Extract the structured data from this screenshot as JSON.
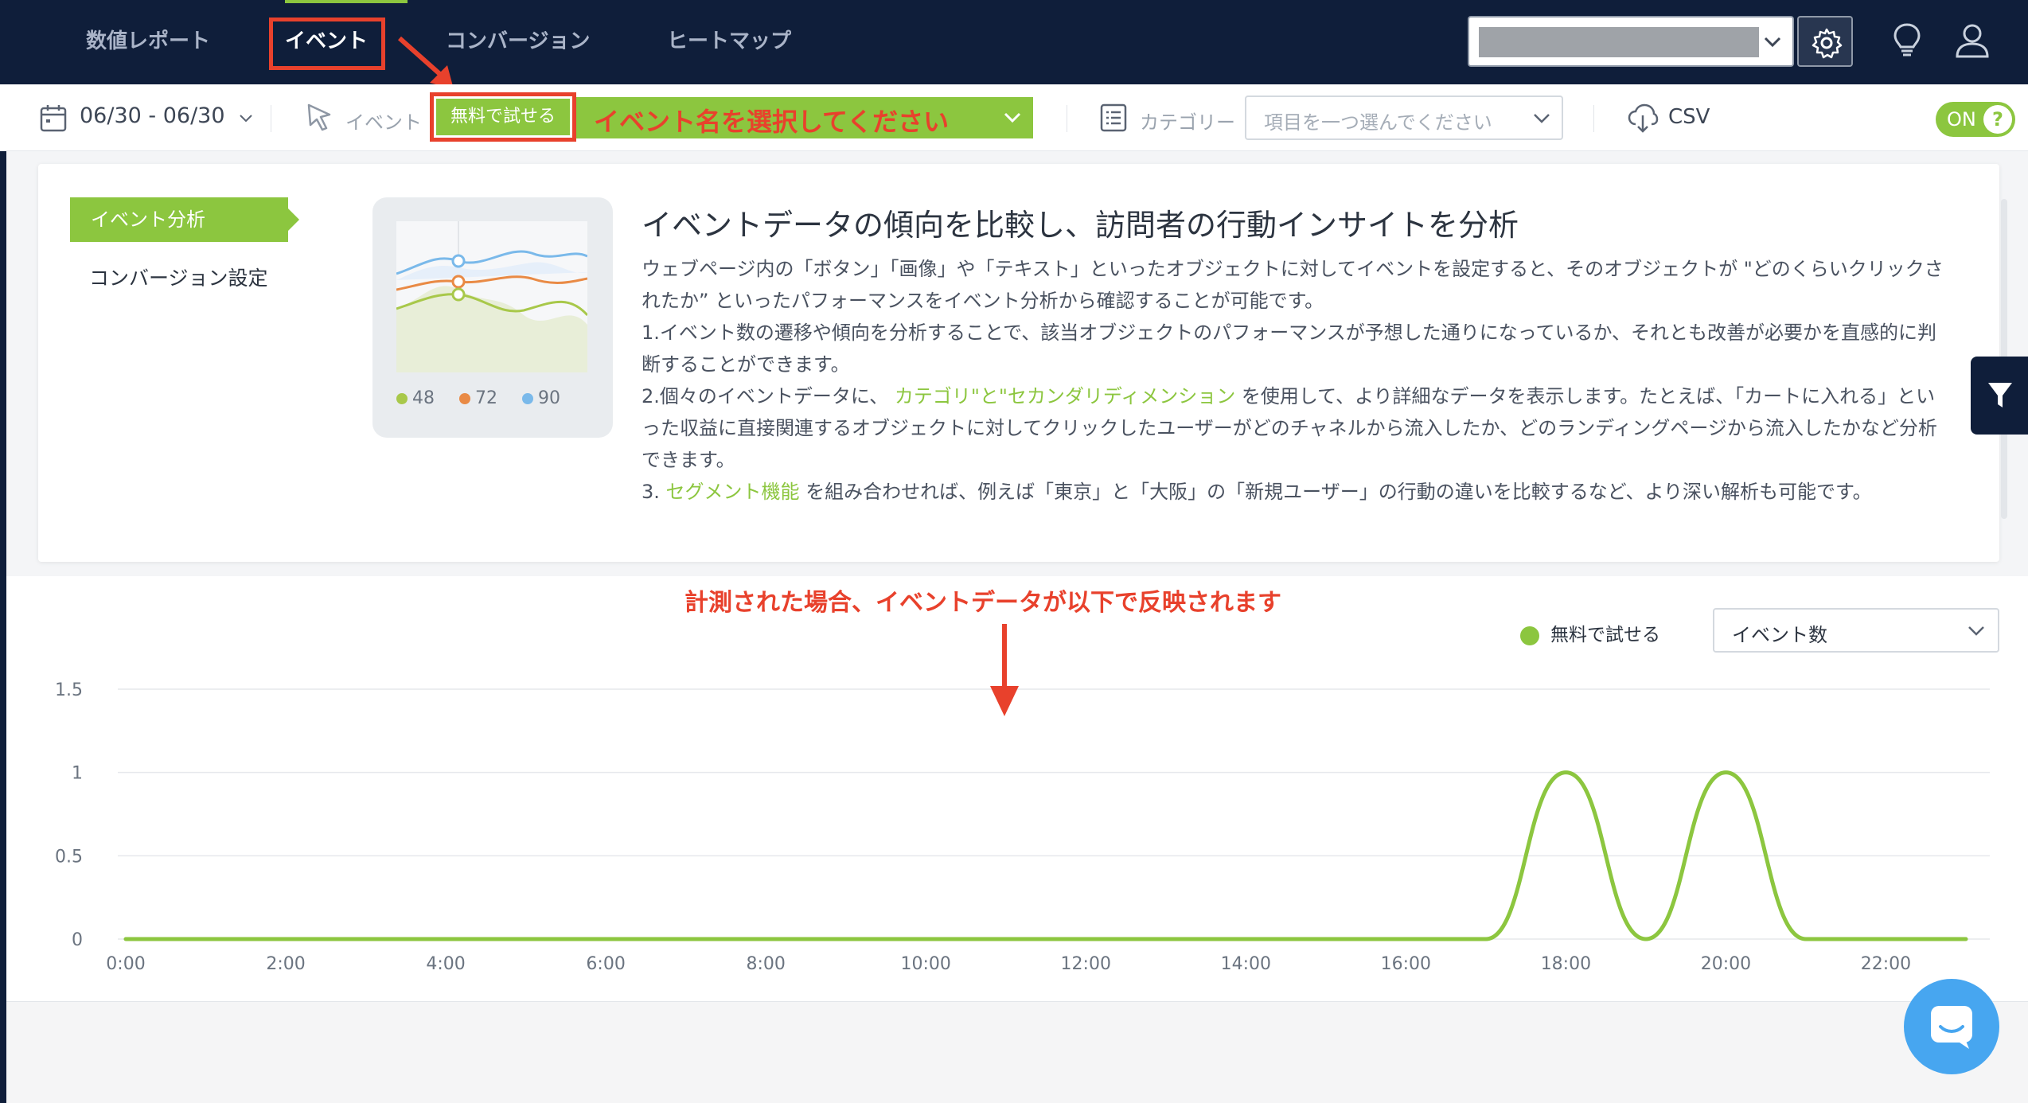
{
  "nav": {
    "tabs": [
      {
        "label": "数値レポート"
      },
      {
        "label": "イベント"
      },
      {
        "label": "コンバージョン"
      },
      {
        "label": "ヒートマップ"
      }
    ]
  },
  "toolbar": {
    "date_range": "06/30 - 06/30",
    "event_label": "イベント",
    "event_chip": "無料で試せる",
    "event_select_annotation": "イベント名を選択してください",
    "category_label": "カテゴリー",
    "category_placeholder": "項目を一つ選んでください",
    "csv_label": "CSV",
    "toggle_label": "ON",
    "toggle_help": "?"
  },
  "info": {
    "sidebar": [
      {
        "label": "イベント分析",
        "active": true
      },
      {
        "label": "コンバージョン設定",
        "active": false
      }
    ],
    "thumb_legend": [
      "48",
      "72",
      "90"
    ],
    "title": "イベントデータの傾向を比較し、訪問者の行動インサイトを分析",
    "p1": "ウェブページ内の「ボタン」「画像」や「テキスト」といったオブジェクトに対してイベントを設定すると、そのオブジェクトが \"どのくらいクリックされたか” といったパフォーマンスをイベント分析から確認することが可能です。",
    "p2": "1.イベント数の遷移や傾向を分析することで、該当オブジェクトのパフォーマンスが予想した通りになっているか、それとも改善が必要かを直感的に判断することができます。",
    "p3_pre": "2.個々のイベントデータに、",
    "p3_link": "カテゴリ\"と\"セカンダリディメンション",
    "p3_post": "を使用して、より詳細なデータを表示します。たとえば、「カートに入れる」といった収益に直接関連するオブジェクトに対してクリックしたユーザーがどのチャネルから流入したか、どのランディングページから流入したかなど分析できます。",
    "p4_pre": "3.",
    "p4_link": "セグメント機能",
    "p4_post": "を組み合わせれば、例えば「東京」と「大阪」の「新規ユーザー」の行動の違いを比較するなど、より深い解析も可能です。"
  },
  "chart_annotation": "計測された場合、イベントデータが以下で反映されます",
  "metric_select": "イベント数",
  "colors": {
    "accent": "#8cc63f",
    "nav_bg": "#0f1e3a",
    "annotation": "#e8412c",
    "chat": "#47a6f0"
  },
  "chart_data": {
    "type": "line",
    "x": [
      "0:00",
      "1:00",
      "2:00",
      "3:00",
      "4:00",
      "5:00",
      "6:00",
      "7:00",
      "8:00",
      "9:00",
      "10:00",
      "11:00",
      "12:00",
      "13:00",
      "14:00",
      "15:00",
      "16:00",
      "17:00",
      "18:00",
      "19:00",
      "20:00",
      "21:00",
      "22:00",
      "23:00"
    ],
    "x_tick_labels": [
      "0:00",
      "2:00",
      "4:00",
      "6:00",
      "8:00",
      "10:00",
      "12:00",
      "14:00",
      "16:00",
      "18:00",
      "20:00",
      "22:00"
    ],
    "series": [
      {
        "name": "無料で試せる",
        "values": [
          0,
          0,
          0,
          0,
          0,
          0,
          0,
          0,
          0,
          0,
          0,
          0,
          0,
          0,
          0,
          0,
          0,
          0,
          1,
          0,
          1,
          0,
          0,
          0
        ]
      }
    ],
    "y_tick_labels": [
      "0",
      "0.5",
      "1",
      "1.5"
    ],
    "ylim": [
      0,
      1.5
    ],
    "grid": true,
    "legend": "top-right"
  }
}
